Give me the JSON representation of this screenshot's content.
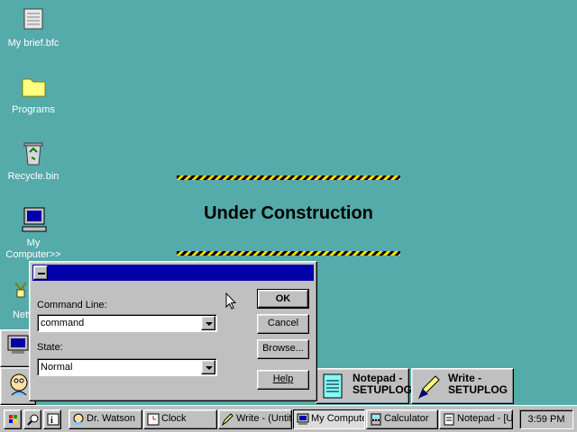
{
  "desktop": {
    "icons": [
      {
        "label": "My brief.bfc",
        "icon": "briefcase-icon"
      },
      {
        "label": "Programs",
        "icon": "folder-icon"
      },
      {
        "label": "Recycle.bin",
        "icon": "recycle-bin-icon"
      },
      {
        "label": "My Computer>>",
        "icon": "computer-icon"
      },
      {
        "label": "Netw",
        "icon": "network-icon"
      }
    ],
    "banner": "Under Construction"
  },
  "run_dialog": {
    "title": "",
    "command_label": "Command Line:",
    "command_value": "command",
    "state_label": "State:",
    "state_value": "Normal",
    "ok_label": "OK",
    "cancel_label": "Cancel",
    "browse_label": "Browse...",
    "help_label": "Help"
  },
  "tiles": [
    {
      "label1": "Notepad -",
      "label2": "SETUPLOG",
      "icon": "notepad-icon"
    },
    {
      "label1": "Write -",
      "label2": "SETUPLOG",
      "icon": "write-pen-icon"
    }
  ],
  "taskbar": {
    "buttons": [
      {
        "label": "Dr. Watson",
        "icon": "dr-watson-icon"
      },
      {
        "label": "Clock",
        "icon": "clock-icon"
      },
      {
        "label": "Write - (Untit",
        "icon": "write-pen-icon"
      },
      {
        "label": "My Compute",
        "icon": "computer-icon"
      },
      {
        "label": "Calculator",
        "icon": "calculator-icon"
      },
      {
        "label": "Notepad - [U",
        "icon": "notepad-icon"
      }
    ],
    "clock": "3:59 PM"
  },
  "colors": {
    "desktop": "#55aaaa",
    "titlebar": "#0000a8",
    "face": "#c0c0c0"
  }
}
